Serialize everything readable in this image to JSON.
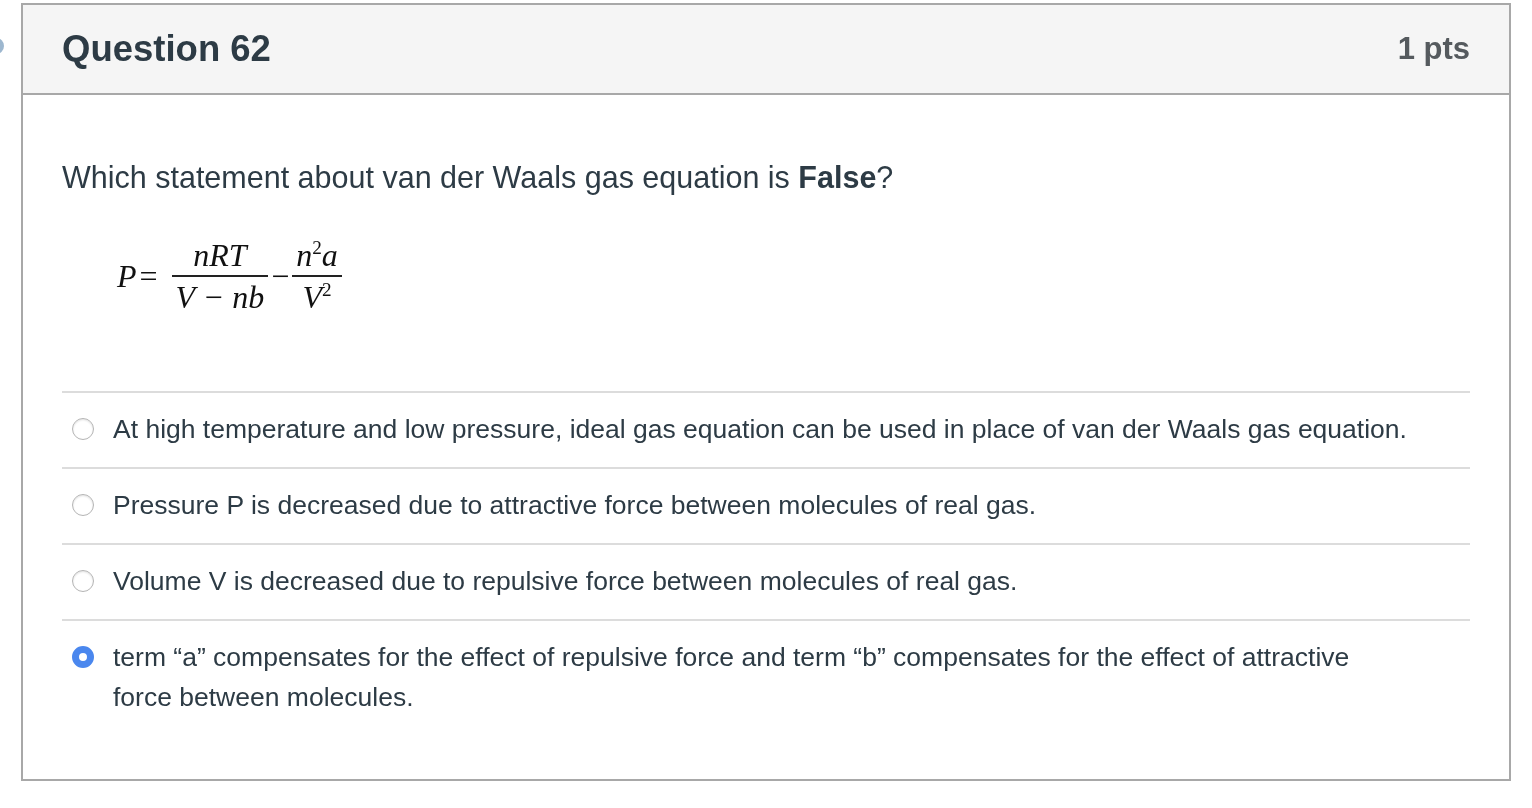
{
  "question": {
    "title": "Question 62",
    "points": "1 pts"
  },
  "prompt": "Which statement about van der Waals gas equation is **False**?",
  "equation": {
    "lhs": "P",
    "terms": [
      {
        "operator": "=",
        "numerator": "nRT",
        "denominator": "V − nb"
      },
      {
        "operator": "−",
        "numerator": "n$^{2}$a",
        "denominator": "V$^{2}$"
      }
    ]
  },
  "answers": [
    {
      "text": "At high temperature and low pressure, ideal gas equation can be used in place of van der Waals gas equation.",
      "selected": false
    },
    {
      "text": "Pressure P is decreased due to attractive force between molecules of real gas.",
      "selected": false
    },
    {
      "text": "Volume V is decreased due to repulsive force between molecules of real gas.",
      "selected": false
    },
    {
      "text": "term “a” compensates for the effect of repulsive force and term “b” compensates for the effect of attractive force between molecules.",
      "selected": true
    }
  ]
}
